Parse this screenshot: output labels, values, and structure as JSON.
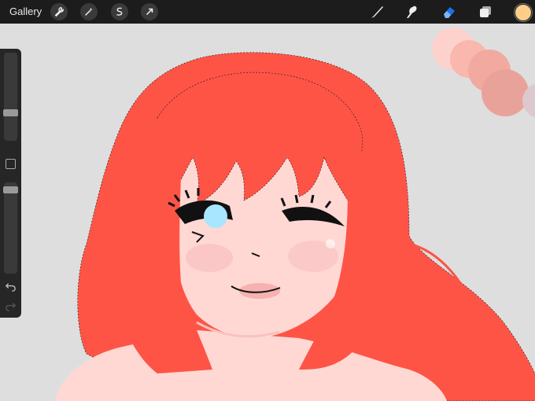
{
  "toolbar": {
    "gallery_label": "Gallery",
    "left_actions": [
      "wrench-icon",
      "magic-wand-icon",
      "selection-icon",
      "transform-arrow-icon"
    ],
    "right_tools": [
      "brush-icon",
      "smudge-icon",
      "eraser-icon",
      "layers-icon"
    ],
    "active_tool": "eraser-icon",
    "accent_color": "#1a73e8",
    "current_color": "#ffcf8a"
  },
  "sidebar": {
    "brush_size_level": 0.3,
    "opacity_level": 0.05,
    "undo_icon": "undo-icon",
    "redo_icon": "redo-icon"
  },
  "canvas": {
    "background_color": "#dedede",
    "hair_color": "#fe5446",
    "skin_color": "#ffd8d3",
    "eye_color": "#a8e6ff",
    "palette_swatches": [
      "#fdd1cc",
      "#f9b7ad",
      "#f2a9a0",
      "#e9a29a",
      "#dcc8cd"
    ]
  }
}
